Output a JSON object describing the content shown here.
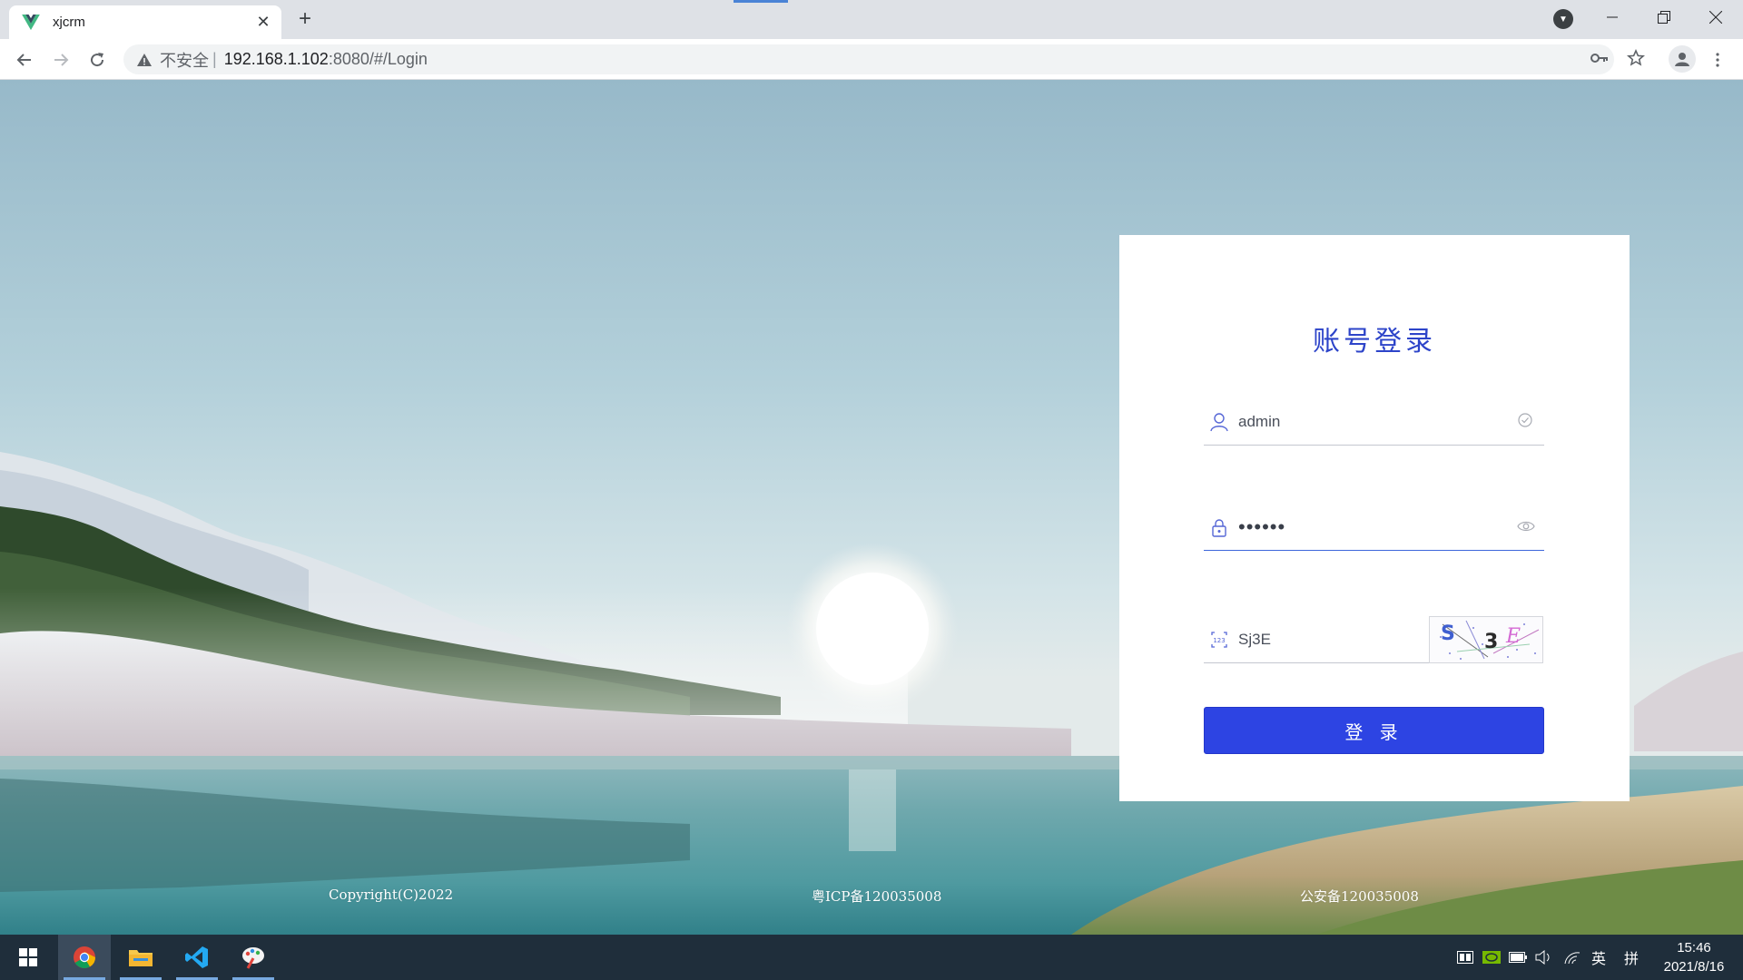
{
  "browser": {
    "tab": {
      "title": "xjcrm",
      "close": "✕"
    },
    "new_tab": "+",
    "address": {
      "security_label": "不安全",
      "separator": "|",
      "host": "192.168.1.102",
      "rest": ":8080/#/Login"
    }
  },
  "login": {
    "title": "账号登录",
    "username": {
      "value": "admin"
    },
    "password": {
      "value": "••••••"
    },
    "captcha": {
      "value": "Sj3E",
      "image_text": "S 3 E"
    },
    "submit_label": "登 录"
  },
  "footer": {
    "copyright": "Copyright(C)2022",
    "icp": "粤ICP备120035008",
    "police": "公安备120035008"
  },
  "taskbar": {
    "apps": [
      "start-icon",
      "chrome-icon",
      "file-explorer-icon",
      "vscode-icon",
      "paint-icon"
    ],
    "tray": {
      "ime_lang": "英",
      "ime_grid": "拼"
    },
    "clock": {
      "time": "15:46",
      "date": "2021/8/16"
    }
  },
  "colors": {
    "accent": "#2d44e3",
    "title": "#2d44c9",
    "taskbar": "#1f2e3b"
  }
}
